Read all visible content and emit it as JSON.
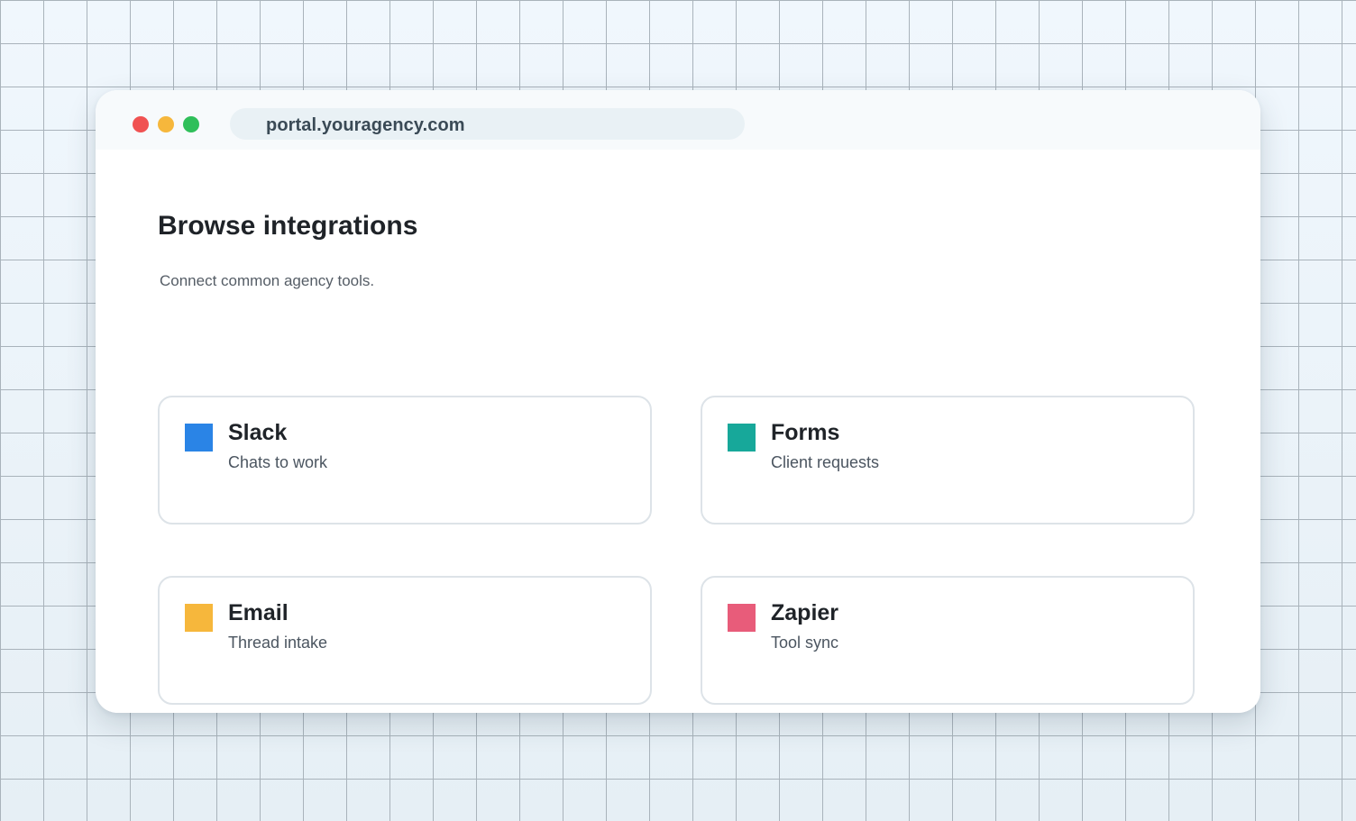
{
  "browser": {
    "url": "portal.youragency.com",
    "controls": {
      "close_color": "#f05252",
      "minimize_color": "#f6b73c",
      "maximize_color": "#2fbf5a"
    }
  },
  "page": {
    "title": "Browse integrations",
    "subtitle": "Connect common agency tools."
  },
  "integrations": [
    {
      "name": "Slack",
      "description": "Chats to work",
      "color": "#2a84e6"
    },
    {
      "name": "Forms",
      "description": "Client requests",
      "color": "#17a89a"
    },
    {
      "name": "Email",
      "description": "Thread intake",
      "color": "#f6b73c"
    },
    {
      "name": "Zapier",
      "description": "Tool sync",
      "color": "#e85c7a"
    }
  ]
}
